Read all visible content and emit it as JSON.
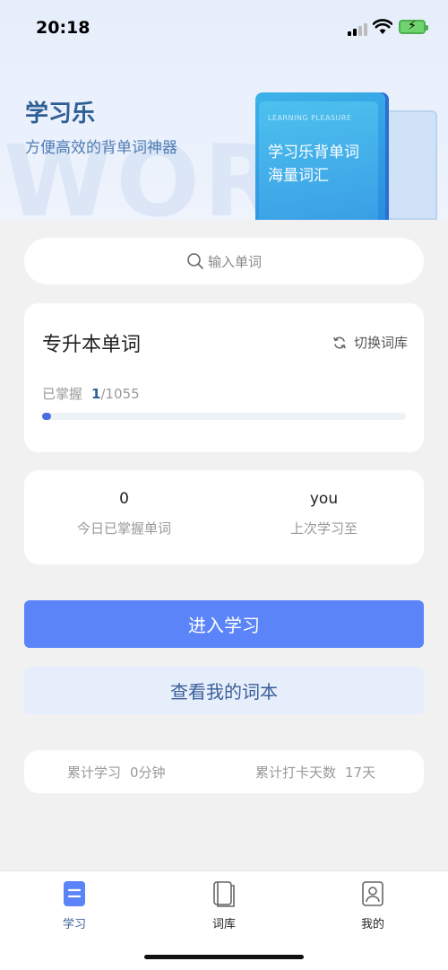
{
  "status_bar": {
    "time": "20:18"
  },
  "hero": {
    "title": "学习乐",
    "subtitle": "方便高效的背单词神器",
    "watermark": "WORD",
    "book_en": "LEARNING PLEASURE",
    "book_line1": "学习乐背单词",
    "book_line2": "海量词汇"
  },
  "search": {
    "placeholder": "输入单词"
  },
  "wordbook": {
    "title": "专升本单词",
    "switch_label": "切换词库",
    "mastered_label": "已掌握",
    "mastered_count": "1",
    "total_text": "/1055",
    "progress": 0.001
  },
  "stats": [
    {
      "value": "0",
      "label": "今日已掌握单词"
    },
    {
      "value": "you",
      "label": "上次学习至"
    }
  ],
  "buttons": {
    "enter": "进入学习",
    "view": "查看我的词本"
  },
  "totals": {
    "study_label": "累计学习",
    "study_value": "0分钟",
    "checkin_label": "累计打卡天数",
    "checkin_value": "17天"
  },
  "tabs": [
    {
      "label": "学习",
      "icon": "study-icon",
      "active": true
    },
    {
      "label": "词库",
      "icon": "book-icon",
      "active": false
    },
    {
      "label": "我的",
      "icon": "profile-icon",
      "active": false
    }
  ],
  "colors": {
    "accent": "#5b84f8",
    "title": "#2f5e95",
    "secondary_bg": "#e7eefb"
  }
}
